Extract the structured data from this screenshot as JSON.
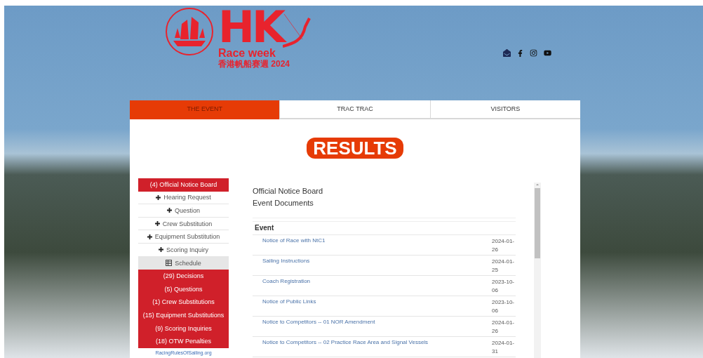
{
  "logo": {
    "letters": "HK",
    "line_1": "Race week",
    "line_2": "香港帆船赛週 2024"
  },
  "tabs": [
    {
      "label": "THE EVENT",
      "selected": true
    },
    {
      "label": "TRAC TRAC",
      "selected": false
    },
    {
      "label": "VISITORS",
      "selected": false
    }
  ],
  "banner": "RESULTS",
  "sidebar": {
    "items": [
      {
        "kind": "header",
        "label": "(4) Official Notice Board"
      },
      {
        "kind": "action",
        "label": "Hearing Request"
      },
      {
        "kind": "action",
        "label": "Question"
      },
      {
        "kind": "action",
        "label": "Crew Substitution"
      },
      {
        "kind": "action",
        "label": "Equipment Substitution"
      },
      {
        "kind": "action",
        "label": "Scoring Inquiry"
      },
      {
        "kind": "schedule",
        "label": "Schedule"
      },
      {
        "kind": "count",
        "label": "(29) Decisions"
      },
      {
        "kind": "count",
        "label": "(5) Questions"
      },
      {
        "kind": "count",
        "label": "(1) Crew Substitutions"
      },
      {
        "kind": "count",
        "label": "(15) Equipment Substitutions"
      },
      {
        "kind": "count",
        "label": "(9) Scoring Inquiries"
      },
      {
        "kind": "count",
        "label": "(18) OTW Penalties"
      }
    ],
    "footer_link": "RacingRulesOfSailing.org"
  },
  "main": {
    "title": "Official Notice Board",
    "subtitle": "Event Documents",
    "section": "Event",
    "rows": [
      {
        "name": "Notice of Race with NtC1",
        "date": "2024-01-26"
      },
      {
        "name": "Sailing Instructions",
        "date": "2024-01-25"
      },
      {
        "name": "Coach Registration",
        "date": "2023-10-06"
      },
      {
        "name": "Notice of Public Links",
        "date": "2023-10-06"
      },
      {
        "name": "Notice to Competitors -- 01 NOR Amendment",
        "date": "2024-01-26"
      },
      {
        "name": "Notice to Competitors -- 02 Practice Race Area and Signal Vessels",
        "date": "2024-01-31"
      }
    ]
  }
}
